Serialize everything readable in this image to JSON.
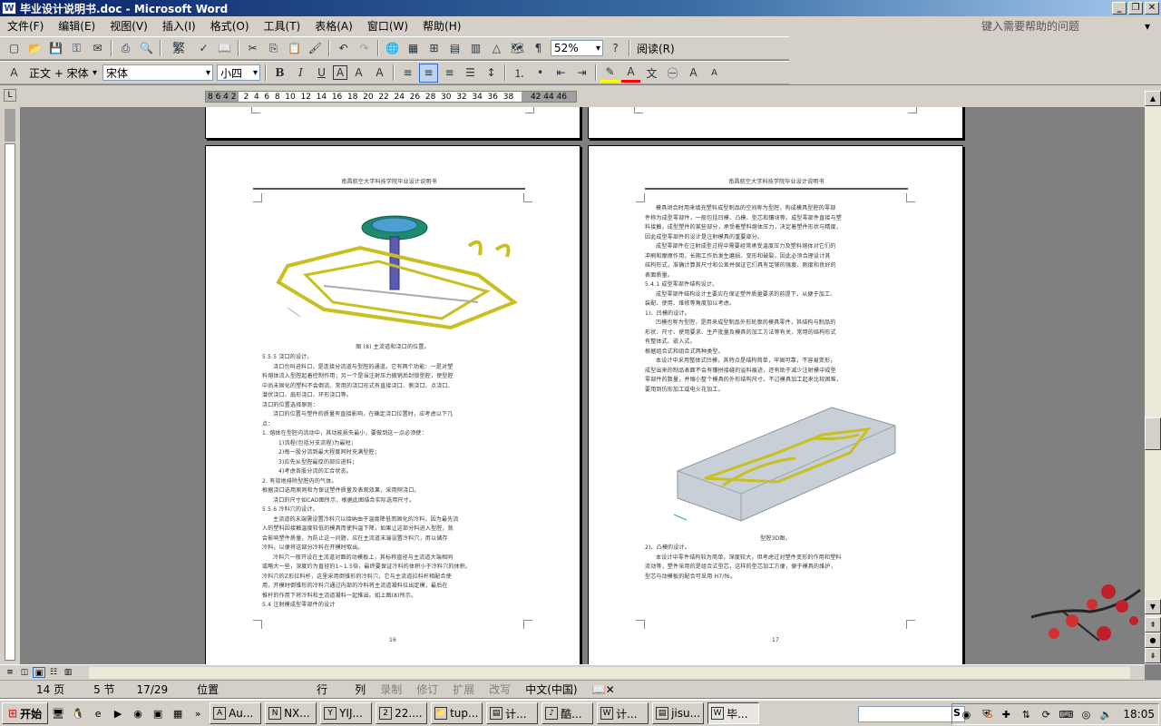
{
  "window": {
    "title": "毕业设计说明书.doc - Microsoft Word"
  },
  "menu": {
    "items": [
      "文件(F)",
      "编辑(E)",
      "视图(V)",
      "插入(I)",
      "格式(O)",
      "工具(T)",
      "表格(A)",
      "窗口(W)",
      "帮助(H)"
    ],
    "help_placeholder": "键入需要帮助的问题"
  },
  "toolbar": {
    "zoom": "52%",
    "read_label": "阅读(R)",
    "style_value": "正文 + 宋体",
    "font_value": "宋体",
    "size_value": "小四",
    "bold": "B",
    "italic": "I",
    "underline": "U",
    "fanti": "繁"
  },
  "ruler": {
    "left_numbers": "8 6 4 2",
    "numbers": "2  4  6  8  10  12  14  16  18  20  22  24  26  28  30  32  34  36  38",
    "right_numbers": "42 44 46"
  },
  "pages": {
    "left_header": "南昌航空大学科技学院毕业设计说明书",
    "right_header": "南昌航空大学科技学院毕业设计说明书",
    "left_caption": "图 (8) 主流道和浇口的位置。",
    "right_caption": "型腔3D图。",
    "left_page_no": "16",
    "right_page_no": "17",
    "left_lines": [
      "5.5.5  浇口的设计。",
      "浇口也叫进料口，是连接分流道与型腔的通道。它有两个功能：一是对塑",
      "料熔体流入型腔起着控制作用；另一个是当注射压力撤销后封锁型腔，使型腔",
      "中尚未固化的塑料不会倒流。常用的浇口形式有直接浇口、侧浇口、点浇口、",
      "潜伏浇口、扇形浇口、环形浇口等。",
      "浇口的位置选择原则：",
      "浇口的位置与塑件的质量有直接影响，在确定浇口位置时，应考虑以下几",
      "点：",
      "1. 熔体在型腔内流动中，其动能损失最小，要做到这一点必须使：",
      "1)流程(包括分支流程)为最短；",
      "2)每一股分流到最大程度同时充满型腔；",
      "3)应先从型腔最厚的部位进料；",
      "4)考虑各股分流的汇合状态。",
      "2. 有效地排除型腔内的气体。",
      "根据浇口选用原则和为保证塑件质量及表观效果，采用侧浇口。",
      "浇口的尺寸如CAD图所示，根据此图结合实际选用尺寸。",
      "5.5.6  冷料穴的设计。",
      "主流道的末端需设置冷料穴以接纳由于温度降低而固化的冷料，因为最先流",
      "入的塑料因接触温度较低的模具而使料温下降，如果让这部分料进入型腔，就",
      "会影响塑件质量，为防止这一问题，应在主流道末端设置冷料穴，用以储存",
      "冷料，以便将这部分冷料在开模时取出。",
      "冷料穴一般开设在主流道对面的动模板上，其标称直径与主流道大端相同",
      "或略大一些，深度约为直径的1~1.5倍，最终要保证冷料的体积小于冷料穴的体积。",
      "冷料穴的Z形拉料杆，这里采用倒锥形的冷料穴，它与主流道拉料杆相配合使",
      "用，开模时倒锥形的冷料穴通过内部的冷料将主流道凝料拉出定模，最后在",
      "推杆的作用下将冷料和主流道凝料一起推出。如上图(8)所示。",
      "5.4  注射模成型零部件的设计"
    ],
    "right_lines": [
      "模具闭合时用来填充塑料成型制品的空间称为型腔，构成模具型腔的零部",
      "件称为成型零部件，一般包括凹模、凸模、型芯和镶块等。成型零部件直接与塑",
      "料接触，成型塑件的某些部分，承受着塑料熔体压力，决定着塑件形状与精度，",
      "因此成型零部件的设计是注射模具的重要部分。",
      "成型零部件在注射成型过程中需要经常承受温度压力及塑料熔体对它们的",
      "冲刷和摩擦作用，长期工作后发生磨损、变形和破裂，因此必须合理设计其",
      "结构形式，准确计算其尺寸和公差并保证它们具有足够的强度、刚度和良好的",
      "表面质量。",
      "5.4.1  成型零部件结构设计。",
      "成型零部件结构设计主要应在保证塑件质量要求的前提下，从便于加工、",
      "装配、使用、维修等角度加以考虑。",
      "1)、凹模的设计。",
      "凹模也称为型腔，是用来成型制品外形轮廓的模具零件，其结构与制品的",
      "形状、尺寸、使用要求、生产批量及模具的加工方法等有关，常用的结构形式",
      "有整体式、嵌入式。",
      "根据组合式和组合式两种类型。",
      "本设计中采用整体式凹模，其特点是结构简单，牢固可靠，不容易变形，",
      "成型出来的制品表面不会有镶拼接缝的溢料痕迹，还有助于减少注射模中成型",
      "零部件的数量，并缩小整个模具的外形结构尺寸。不过模具加工起来比较困难，",
      "要用到仿形加工或电火花加工。"
    ],
    "right_lines_bottom": [
      "2)、凸模的设计。",
      "本设计中零件结构较为简单，深度较大，但考虑过对塑件变形的作用和塑料",
      "流动等，塑件采用的是组合式型芯，这样的型芯加工方便，便于模具的维护，",
      "型芯与动模板的配合可采用 H7/f6。"
    ]
  },
  "status": {
    "page": "14 页",
    "section": "5 节",
    "pages": "17/29",
    "position": "位置",
    "line": "行",
    "col": "列",
    "rec": "录制",
    "trk": "修订",
    "ext": "扩展",
    "ovr": "改写",
    "lang": "中文(中国)"
  },
  "taskbar": {
    "start": "开始",
    "tasks": [
      "Au...",
      "NX...",
      "YIJ...",
      "22....",
      "tup...",
      "计...",
      "酷...",
      "计...",
      "jisu...",
      "毕..."
    ],
    "clock": "18:05",
    "search_badge": "S"
  },
  "colors": {
    "titlebar": "#0a246a",
    "accent": "#3a6ea5",
    "chrome": "#d4d0c8"
  }
}
